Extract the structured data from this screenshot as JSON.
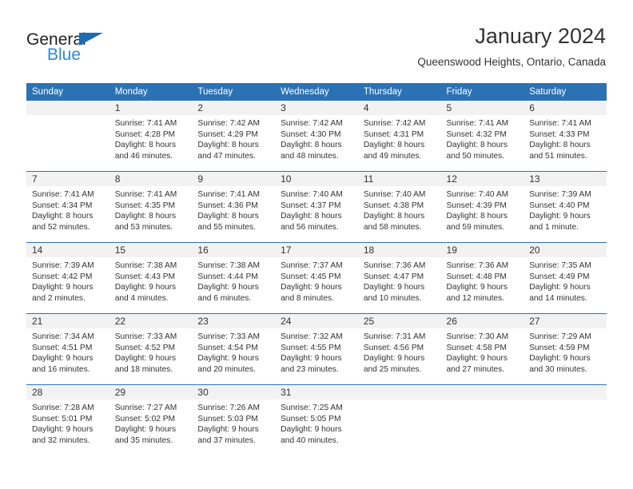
{
  "brand": {
    "name_top": "General",
    "name_bottom": "Blue",
    "triangle_color": "#1b6cb0",
    "blue_text_color": "#2b8ad6"
  },
  "header": {
    "title": "January 2024",
    "subtitle": "Queenswood Heights, Ontario, Canada"
  },
  "theme": {
    "header_blue": "#2b72b5",
    "daynum_bg": "#f2f2f2",
    "text": "#333333"
  },
  "weekday_headers": [
    "Sunday",
    "Monday",
    "Tuesday",
    "Wednesday",
    "Thursday",
    "Friday",
    "Saturday"
  ],
  "labels": {
    "sunrise_prefix": "Sunrise:",
    "sunset_prefix": "Sunset:",
    "daylight_prefix": "Daylight:"
  },
  "weeks": [
    [
      {
        "day": "",
        "sunrise": "",
        "sunset": "",
        "daylight": ""
      },
      {
        "day": "1",
        "sunrise": "Sunrise: 7:41 AM",
        "sunset": "Sunset: 4:28 PM",
        "daylight": "Daylight: 8 hours and 46 minutes."
      },
      {
        "day": "2",
        "sunrise": "Sunrise: 7:42 AM",
        "sunset": "Sunset: 4:29 PM",
        "daylight": "Daylight: 8 hours and 47 minutes."
      },
      {
        "day": "3",
        "sunrise": "Sunrise: 7:42 AM",
        "sunset": "Sunset: 4:30 PM",
        "daylight": "Daylight: 8 hours and 48 minutes."
      },
      {
        "day": "4",
        "sunrise": "Sunrise: 7:42 AM",
        "sunset": "Sunset: 4:31 PM",
        "daylight": "Daylight: 8 hours and 49 minutes."
      },
      {
        "day": "5",
        "sunrise": "Sunrise: 7:41 AM",
        "sunset": "Sunset: 4:32 PM",
        "daylight": "Daylight: 8 hours and 50 minutes."
      },
      {
        "day": "6",
        "sunrise": "Sunrise: 7:41 AM",
        "sunset": "Sunset: 4:33 PM",
        "daylight": "Daylight: 8 hours and 51 minutes."
      }
    ],
    [
      {
        "day": "7",
        "sunrise": "Sunrise: 7:41 AM",
        "sunset": "Sunset: 4:34 PM",
        "daylight": "Daylight: 8 hours and 52 minutes."
      },
      {
        "day": "8",
        "sunrise": "Sunrise: 7:41 AM",
        "sunset": "Sunset: 4:35 PM",
        "daylight": "Daylight: 8 hours and 53 minutes."
      },
      {
        "day": "9",
        "sunrise": "Sunrise: 7:41 AM",
        "sunset": "Sunset: 4:36 PM",
        "daylight": "Daylight: 8 hours and 55 minutes."
      },
      {
        "day": "10",
        "sunrise": "Sunrise: 7:40 AM",
        "sunset": "Sunset: 4:37 PM",
        "daylight": "Daylight: 8 hours and 56 minutes."
      },
      {
        "day": "11",
        "sunrise": "Sunrise: 7:40 AM",
        "sunset": "Sunset: 4:38 PM",
        "daylight": "Daylight: 8 hours and 58 minutes."
      },
      {
        "day": "12",
        "sunrise": "Sunrise: 7:40 AM",
        "sunset": "Sunset: 4:39 PM",
        "daylight": "Daylight: 8 hours and 59 minutes."
      },
      {
        "day": "13",
        "sunrise": "Sunrise: 7:39 AM",
        "sunset": "Sunset: 4:40 PM",
        "daylight": "Daylight: 9 hours and 1 minute."
      }
    ],
    [
      {
        "day": "14",
        "sunrise": "Sunrise: 7:39 AM",
        "sunset": "Sunset: 4:42 PM",
        "daylight": "Daylight: 9 hours and 2 minutes."
      },
      {
        "day": "15",
        "sunrise": "Sunrise: 7:38 AM",
        "sunset": "Sunset: 4:43 PM",
        "daylight": "Daylight: 9 hours and 4 minutes."
      },
      {
        "day": "16",
        "sunrise": "Sunrise: 7:38 AM",
        "sunset": "Sunset: 4:44 PM",
        "daylight": "Daylight: 9 hours and 6 minutes."
      },
      {
        "day": "17",
        "sunrise": "Sunrise: 7:37 AM",
        "sunset": "Sunset: 4:45 PM",
        "daylight": "Daylight: 9 hours and 8 minutes."
      },
      {
        "day": "18",
        "sunrise": "Sunrise: 7:36 AM",
        "sunset": "Sunset: 4:47 PM",
        "daylight": "Daylight: 9 hours and 10 minutes."
      },
      {
        "day": "19",
        "sunrise": "Sunrise: 7:36 AM",
        "sunset": "Sunset: 4:48 PM",
        "daylight": "Daylight: 9 hours and 12 minutes."
      },
      {
        "day": "20",
        "sunrise": "Sunrise: 7:35 AM",
        "sunset": "Sunset: 4:49 PM",
        "daylight": "Daylight: 9 hours and 14 minutes."
      }
    ],
    [
      {
        "day": "21",
        "sunrise": "Sunrise: 7:34 AM",
        "sunset": "Sunset: 4:51 PM",
        "daylight": "Daylight: 9 hours and 16 minutes."
      },
      {
        "day": "22",
        "sunrise": "Sunrise: 7:33 AM",
        "sunset": "Sunset: 4:52 PM",
        "daylight": "Daylight: 9 hours and 18 minutes."
      },
      {
        "day": "23",
        "sunrise": "Sunrise: 7:33 AM",
        "sunset": "Sunset: 4:54 PM",
        "daylight": "Daylight: 9 hours and 20 minutes."
      },
      {
        "day": "24",
        "sunrise": "Sunrise: 7:32 AM",
        "sunset": "Sunset: 4:55 PM",
        "daylight": "Daylight: 9 hours and 23 minutes."
      },
      {
        "day": "25",
        "sunrise": "Sunrise: 7:31 AM",
        "sunset": "Sunset: 4:56 PM",
        "daylight": "Daylight: 9 hours and 25 minutes."
      },
      {
        "day": "26",
        "sunrise": "Sunrise: 7:30 AM",
        "sunset": "Sunset: 4:58 PM",
        "daylight": "Daylight: 9 hours and 27 minutes."
      },
      {
        "day": "27",
        "sunrise": "Sunrise: 7:29 AM",
        "sunset": "Sunset: 4:59 PM",
        "daylight": "Daylight: 9 hours and 30 minutes."
      }
    ],
    [
      {
        "day": "28",
        "sunrise": "Sunrise: 7:28 AM",
        "sunset": "Sunset: 5:01 PM",
        "daylight": "Daylight: 9 hours and 32 minutes."
      },
      {
        "day": "29",
        "sunrise": "Sunrise: 7:27 AM",
        "sunset": "Sunset: 5:02 PM",
        "daylight": "Daylight: 9 hours and 35 minutes."
      },
      {
        "day": "30",
        "sunrise": "Sunrise: 7:26 AM",
        "sunset": "Sunset: 5:03 PM",
        "daylight": "Daylight: 9 hours and 37 minutes."
      },
      {
        "day": "31",
        "sunrise": "Sunrise: 7:25 AM",
        "sunset": "Sunset: 5:05 PM",
        "daylight": "Daylight: 9 hours and 40 minutes."
      },
      {
        "day": "",
        "sunrise": "",
        "sunset": "",
        "daylight": ""
      },
      {
        "day": "",
        "sunrise": "",
        "sunset": "",
        "daylight": ""
      },
      {
        "day": "",
        "sunrise": "",
        "sunset": "",
        "daylight": ""
      }
    ]
  ]
}
